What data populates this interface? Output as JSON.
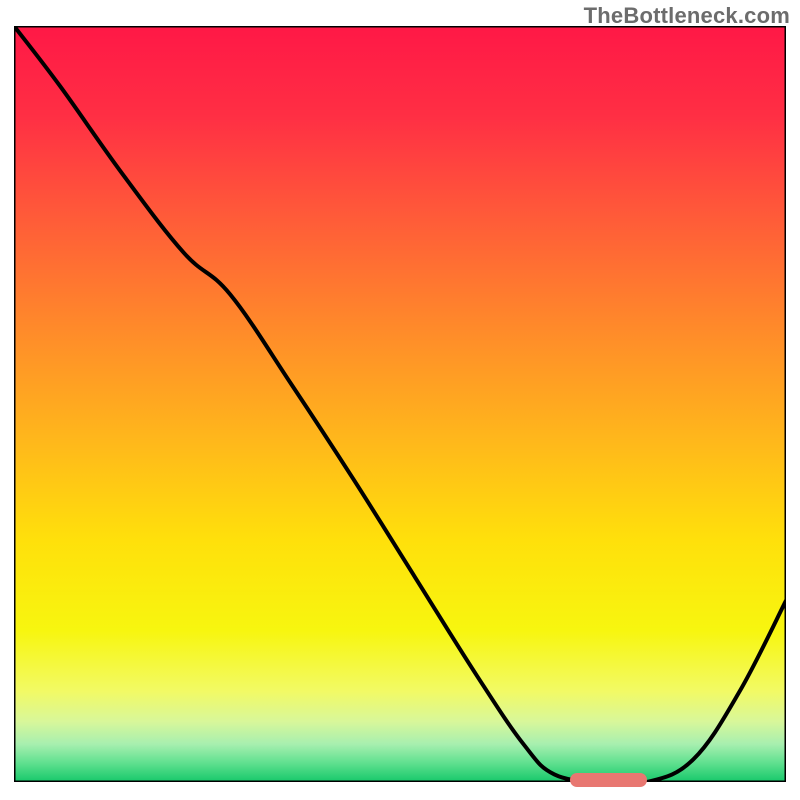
{
  "watermark": "TheBottleneck.com",
  "chart_data": {
    "type": "line",
    "note": "Axes are unlabeled; values are estimated in percent of plot width/height from bottom-left origin (x right, y up).",
    "title": "",
    "xlabel": "",
    "ylabel": "",
    "xlim_pct": [
      0,
      100
    ],
    "ylim_pct": [
      0,
      100
    ],
    "series": [
      {
        "name": "curve",
        "x_pct": [
          0,
          6,
          14,
          22,
          28,
          36,
          44,
          52,
          60,
          66,
          70,
          76,
          82,
          88,
          94,
          100
        ],
        "y_pct": [
          100,
          92,
          80.5,
          70,
          64.5,
          52.5,
          40,
          27,
          14,
          5,
          1,
          0,
          0,
          3,
          12,
          24
        ]
      }
    ],
    "marker": {
      "name": "optimal-range",
      "x_start_pct": 72,
      "x_end_pct": 82,
      "y_pct": 0,
      "color": "#e87771"
    },
    "gradient_stops": [
      {
        "offset": 0.0,
        "color": "#ff1846"
      },
      {
        "offset": 0.12,
        "color": "#ff2f44"
      },
      {
        "offset": 0.25,
        "color": "#ff5a39"
      },
      {
        "offset": 0.4,
        "color": "#ff8a2a"
      },
      {
        "offset": 0.55,
        "color": "#ffb81b"
      },
      {
        "offset": 0.68,
        "color": "#ffe00b"
      },
      {
        "offset": 0.8,
        "color": "#f7f60f"
      },
      {
        "offset": 0.88,
        "color": "#f2fa65"
      },
      {
        "offset": 0.92,
        "color": "#d8f79a"
      },
      {
        "offset": 0.95,
        "color": "#a7efaf"
      },
      {
        "offset": 0.975,
        "color": "#5fe08f"
      },
      {
        "offset": 1.0,
        "color": "#16c86a"
      }
    ],
    "frame_color": "#000000",
    "curve_color": "#000000"
  }
}
